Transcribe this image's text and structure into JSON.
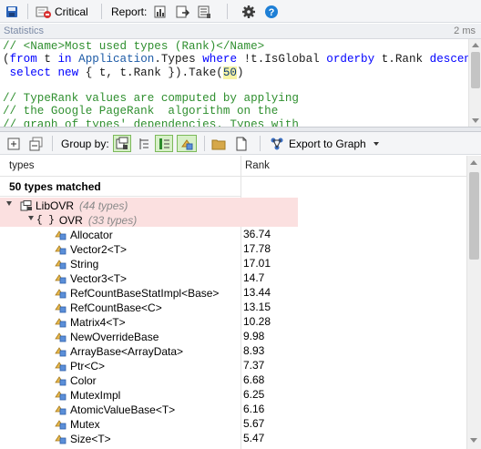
{
  "toolbar": {
    "critical_label": "Critical",
    "report_label": "Report:"
  },
  "stats": {
    "label": "Statistics",
    "time": "2 ms"
  },
  "editor": {
    "lines": [
      [
        {
          "t": "// <Name>Most used types (Rank)</Name>",
          "c": "c-com"
        }
      ],
      [
        {
          "t": "(",
          "c": "c-txt"
        },
        {
          "t": "from",
          "c": "c-kw"
        },
        {
          "t": " t ",
          "c": "c-txt"
        },
        {
          "t": "in",
          "c": "c-kw"
        },
        {
          "t": " ",
          "c": "c-txt"
        },
        {
          "t": "Application",
          "c": "c-id"
        },
        {
          "t": ".Types ",
          "c": "c-txt"
        },
        {
          "t": "where",
          "c": "c-kw"
        },
        {
          "t": " !t.IsGlobal ",
          "c": "c-txt"
        },
        {
          "t": "orderby",
          "c": "c-kw"
        },
        {
          "t": " t.Rank ",
          "c": "c-txt"
        },
        {
          "t": "descending",
          "c": "c-kw"
        }
      ],
      [
        {
          "t": " select",
          "c": "c-kw"
        },
        {
          "t": " ",
          "c": "c-txt"
        },
        {
          "t": "new",
          "c": "c-kw"
        },
        {
          "t": " { t, t.Rank }).Take(",
          "c": "c-txt"
        },
        {
          "t": "50",
          "c": "c-num"
        },
        {
          "t": ")",
          "c": "c-txt"
        }
      ],
      [
        {
          "t": "",
          "c": "c-txt"
        }
      ],
      [
        {
          "t": "// TypeRank values are computed by applying",
          "c": "c-com"
        }
      ],
      [
        {
          "t": "// the Google PageRank  algorithm on the",
          "c": "c-com"
        }
      ],
      [
        {
          "t": "// graph of types' dependencies. Types with",
          "c": "c-com"
        }
      ]
    ]
  },
  "results_toolbar": {
    "group_by_label": "Group by:",
    "export_label": "Export to Graph"
  },
  "grid": {
    "col_types": "types",
    "col_rank": "Rank",
    "matched_label": "50 types matched",
    "assembly": {
      "name": "LibOVR",
      "count": "(44 types)"
    },
    "namespace": {
      "name": "OVR",
      "count": "(33 types)"
    },
    "rows": [
      {
        "name": "Allocator",
        "rank": "36.74"
      },
      {
        "name": "Vector2<T>",
        "rank": "17.78"
      },
      {
        "name": "String",
        "rank": "17.01"
      },
      {
        "name": "Vector3<T>",
        "rank": "14.7"
      },
      {
        "name": "RefCountBaseStatImpl<Base>",
        "rank": "13.44"
      },
      {
        "name": "RefCountBase<C>",
        "rank": "13.15"
      },
      {
        "name": "Matrix4<T>",
        "rank": "10.28"
      },
      {
        "name": "NewOverrideBase",
        "rank": "9.98"
      },
      {
        "name": "ArrayBase<ArrayData>",
        "rank": "8.93"
      },
      {
        "name": "Ptr<C>",
        "rank": "7.37"
      },
      {
        "name": "Color",
        "rank": "6.68"
      },
      {
        "name": "MutexImpl",
        "rank": "6.25"
      },
      {
        "name": "AtomicValueBase<T>",
        "rank": "6.16"
      },
      {
        "name": "Mutex",
        "rank": "5.67"
      },
      {
        "name": "Size<T>",
        "rank": "5.47"
      }
    ]
  },
  "colors": {
    "highlight_row": "#fbe0e0",
    "comment": "#2f8f2f",
    "keyword": "#0000ff",
    "help_icon": "#1e7fd6"
  }
}
